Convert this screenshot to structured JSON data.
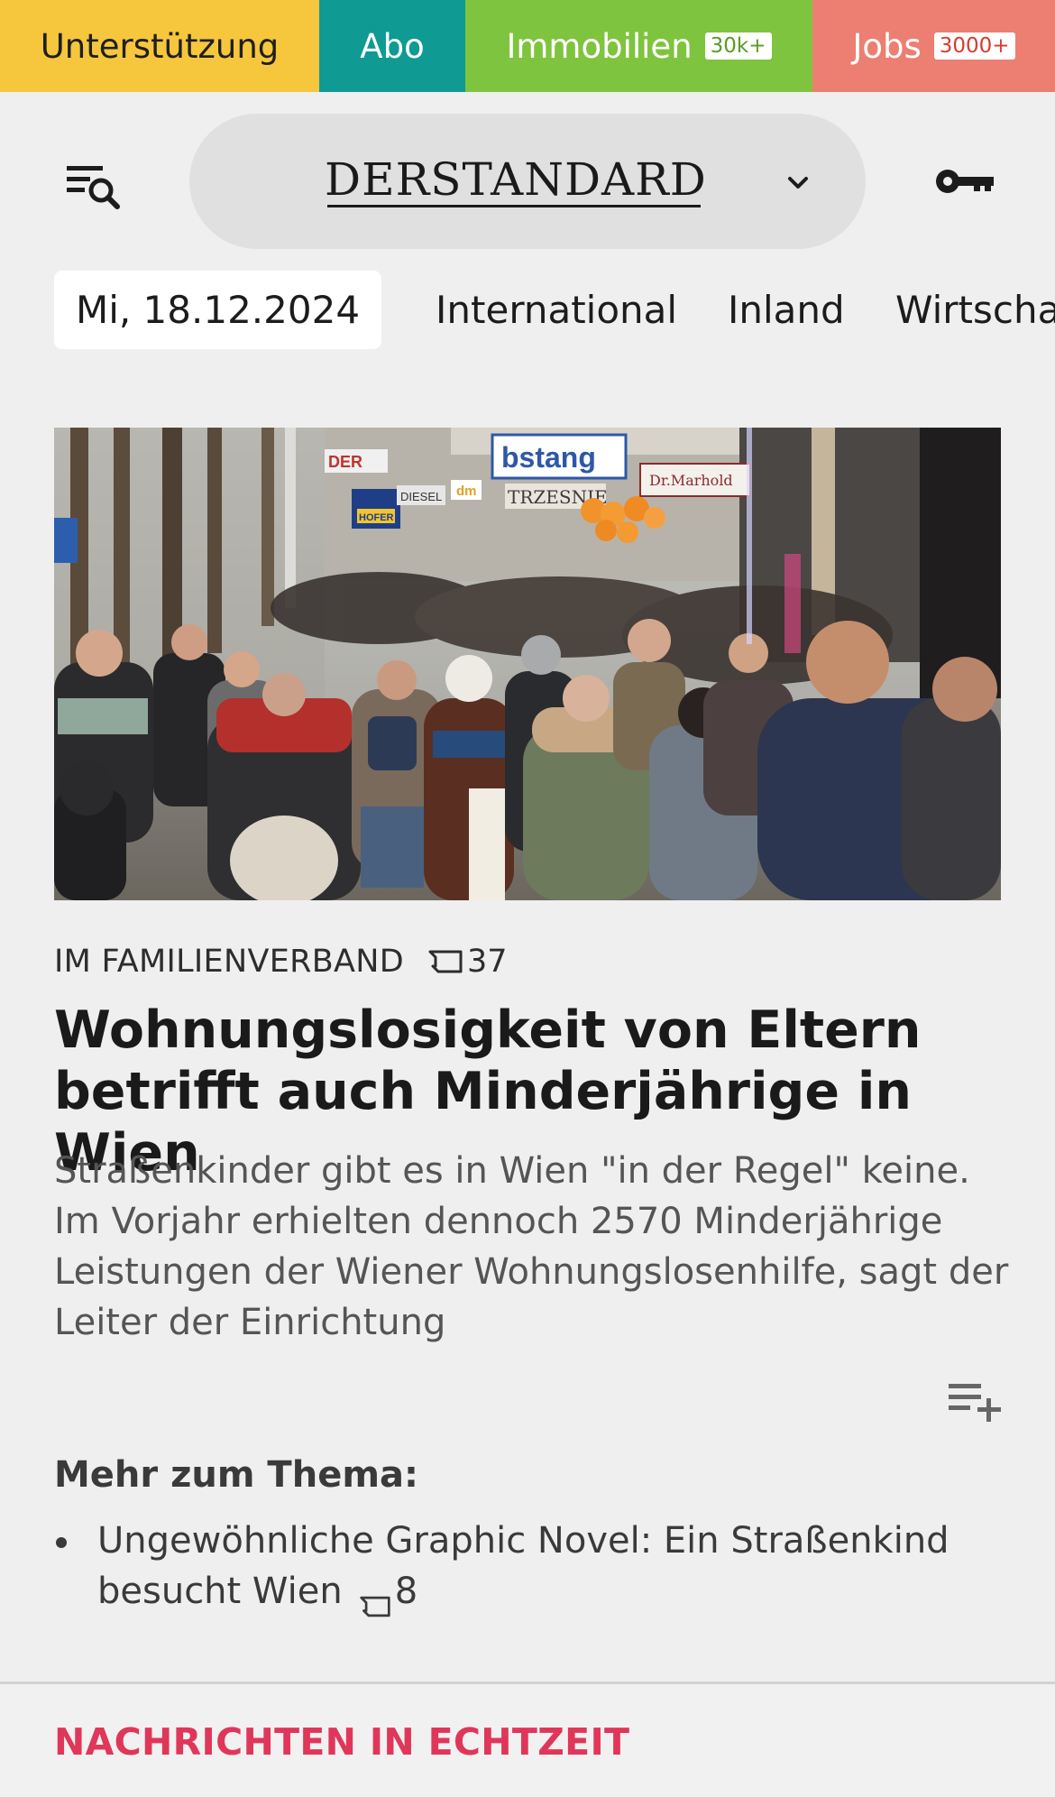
{
  "topbar": {
    "support_label": "Unterstützung",
    "abo_label": "Abo",
    "immo_label": "Immobilien",
    "immo_badge": "30k+",
    "jobs_label": "Jobs",
    "jobs_badge": "3000+",
    "colors": {
      "support": "#f6c63d",
      "abo": "#0f9a94",
      "immo": "#7fc43e",
      "jobs": "#ec7f71"
    }
  },
  "header": {
    "menu_icon": "menu-search-icon",
    "brand": "DERSTANDARD",
    "brand_chevron_icon": "chevron-down-icon",
    "login_icon": "key-icon"
  },
  "nav": {
    "date": "Mi, 18.12.2024",
    "items": [
      "International",
      "Inland",
      "Wirtscha"
    ]
  },
  "article": {
    "kicker": "IM FAMILIENVERBAND",
    "comments": "37",
    "headline": "Wohnungslosigkeit von Eltern betrifft auch Minderjährige in Wien",
    "teaser": "Straßenkinder gibt es in Wien \"in der Regel\" keine. Im Vorjahr erhielten dennoch 2570 Minderjährige Leistungen der Wiener Wohnungslosenhilfe, sagt der Leiter der Einrichtung",
    "save_icon": "playlist-add-icon",
    "hero_signs": [
      "bstang",
      "DER",
      "DIESEL",
      "dm",
      "TRZESNIE",
      "Dr.Marhold",
      "HOFER"
    ]
  },
  "more": {
    "title": "Mehr zum Thema:",
    "items": [
      {
        "text": "Ungewöhnliche Graphic Novel: Ein Straßenkind besucht Wien",
        "comments": "8"
      }
    ]
  },
  "live": {
    "title": "NACHRICHTEN IN ECHTZEIT",
    "accent": "#e0365a"
  }
}
